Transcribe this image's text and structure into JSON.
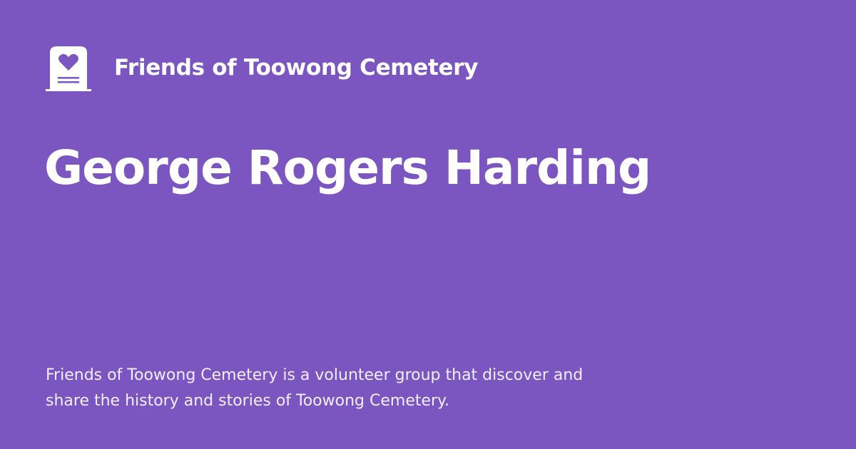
{
  "site": {
    "logo_icon": "tombstone-heart-icon",
    "name": "Friends of Toowong Cemetery"
  },
  "page": {
    "title": "George Rogers Harding",
    "description": "Friends of Toowong Cemetery is a volunteer group that discover and share the history and stories of Toowong Cemetery."
  },
  "colors": {
    "background": "#7b56c1",
    "foreground": "#ffffff"
  }
}
